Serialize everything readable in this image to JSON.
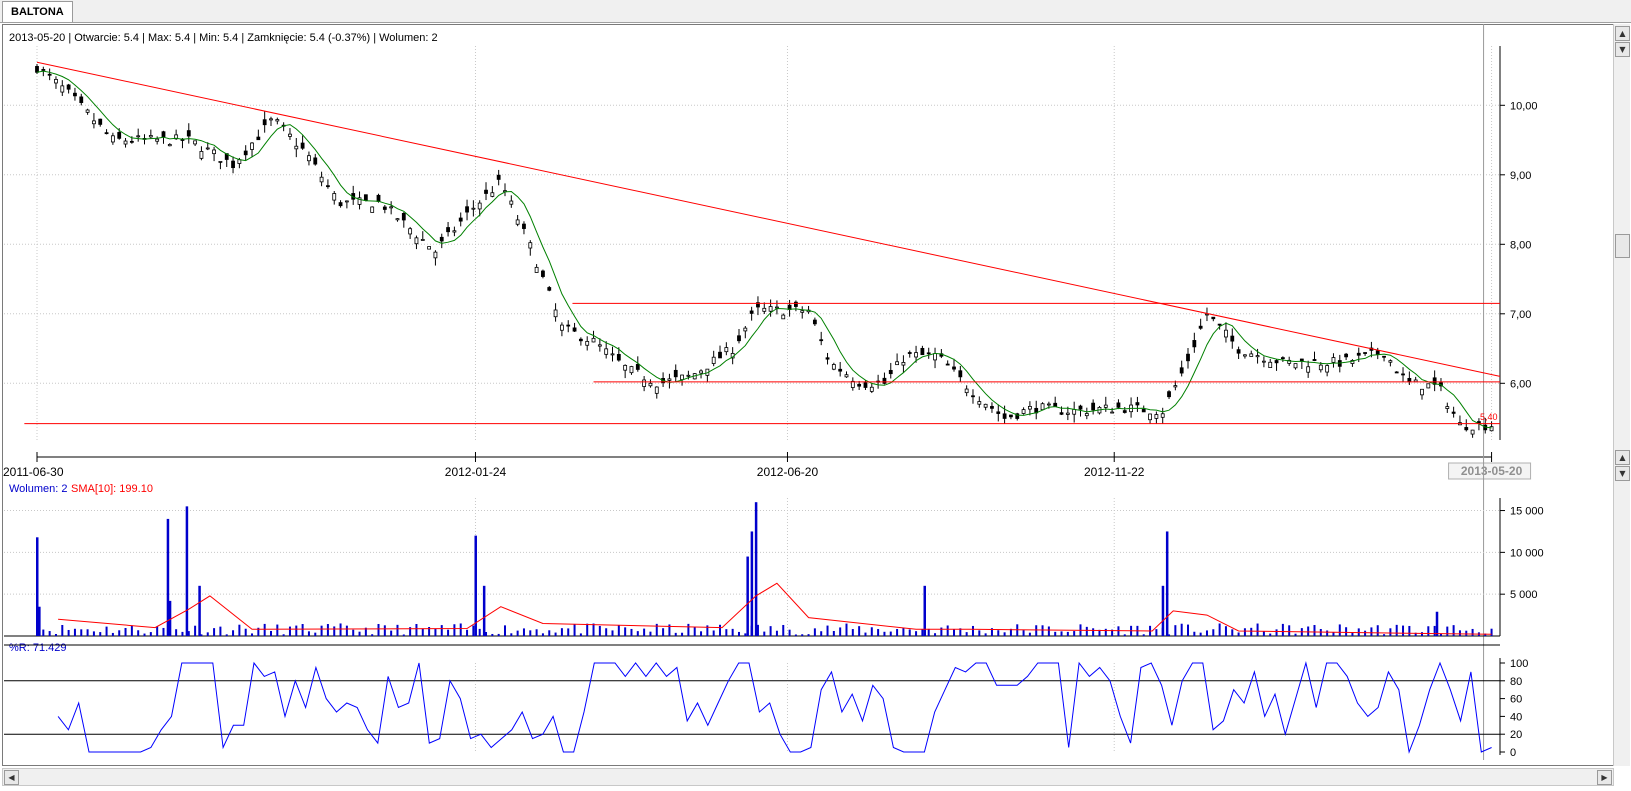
{
  "window": {
    "tab_label": "BALTONA"
  },
  "info_bar": {
    "text": "2013-05-20 | Otwarcie: 5.4 | Max: 5.4 | Min: 5.4 | Zamknięcie: 5.4 (-0.37%)  | Wolumen: 2"
  },
  "last_price_label": "5,40",
  "current_date_label": "2013-05-20",
  "volume_panel": {
    "label": "Wolumen: 2",
    "sma_label": "SMA[10]: 199.10"
  },
  "wr_panel": {
    "label": "%R: 71.429"
  },
  "colors": {
    "price_bar": "#000000",
    "sma_line": "#008000",
    "trend_lines": "#ff0000",
    "volume_bars": "#0000cc",
    "volume_sma": "#ff0000",
    "wr_line": "#0000ff"
  },
  "icons": [
    "scroll-up-icon",
    "scroll-down-icon",
    "scroll-left-icon",
    "scroll-right-icon"
  ],
  "chart_data": [
    {
      "type": "line",
      "name": "price",
      "x_tick_labels": [
        "2011-06-30",
        "2012-01-24",
        "2012-06-20",
        "2012-11-22",
        "2013-05-20"
      ],
      "y_tick_labels": [
        "6,00",
        "7,00",
        "8,00",
        "9,00",
        "10,00"
      ],
      "ylim": [
        5.25,
        10.9
      ],
      "xlim": [
        "2011-06-30",
        "2013-05-24"
      ],
      "price_path": [
        [
          "2011-06-30",
          10.55
        ],
        [
          "2011-07-14",
          10.2
        ],
        [
          "2011-08-05",
          9.5
        ],
        [
          "2011-09-10",
          9.5
        ],
        [
          "2011-10-01",
          9.15
        ],
        [
          "2011-10-20",
          9.8
        ],
        [
          "2011-11-05",
          9.3
        ],
        [
          "2011-11-20",
          8.6
        ],
        [
          "2011-12-10",
          8.6
        ],
        [
          "2012-01-05",
          7.9
        ],
        [
          "2012-01-22",
          8.5
        ],
        [
          "2012-02-05",
          8.9
        ],
        [
          "2012-02-20",
          7.9
        ],
        [
          "2012-03-05",
          6.8
        ],
        [
          "2012-03-20",
          6.6
        ],
        [
          "2012-04-05",
          6.2
        ],
        [
          "2012-04-20",
          6.0
        ],
        [
          "2012-05-05",
          6.1
        ],
        [
          "2012-05-25",
          6.5
        ],
        [
          "2012-06-05",
          7.05
        ],
        [
          "2012-06-30",
          7.05
        ],
        [
          "2012-07-10",
          6.3
        ],
        [
          "2012-07-25",
          6.0
        ],
        [
          "2012-08-05",
          6.0
        ],
        [
          "2012-08-15",
          6.4
        ],
        [
          "2012-08-30",
          6.4
        ],
        [
          "2012-09-15",
          5.9
        ],
        [
          "2012-10-01",
          5.5
        ],
        [
          "2012-10-15",
          5.65
        ],
        [
          "2012-11-01",
          5.6
        ],
        [
          "2012-11-25",
          5.65
        ],
        [
          "2012-12-15",
          5.6
        ],
        [
          "2012-12-25",
          6.2
        ],
        [
          "2013-01-05",
          7.0
        ],
        [
          "2013-01-20",
          6.5
        ],
        [
          "2013-02-10",
          6.3
        ],
        [
          "2013-03-10",
          6.3
        ],
        [
          "2013-03-30",
          6.45
        ],
        [
          "2013-04-10",
          6.0
        ],
        [
          "2013-04-25",
          5.95
        ],
        [
          "2013-05-05",
          5.4
        ],
        [
          "2013-05-20",
          5.4
        ]
      ],
      "trend_lines": [
        {
          "from": [
            "2011-06-30",
            10.62
          ],
          "to": [
            "2013-05-24",
            6.1
          ]
        },
        {
          "from": [
            "2012-03-10",
            7.15
          ],
          "to": [
            "2013-05-24",
            7.15
          ]
        },
        {
          "from": [
            "2012-03-20",
            6.02
          ],
          "to": [
            "2013-05-24",
            6.02
          ]
        },
        {
          "from": [
            "2011-06-24",
            5.42
          ],
          "to": [
            "2013-05-24",
            5.42
          ]
        }
      ]
    },
    {
      "type": "bar",
      "name": "Wolumen",
      "y_tick_labels": [
        "5 000",
        "10 000",
        "15 000"
      ],
      "ylim": [
        0,
        16500
      ],
      "peaks": [
        [
          "2011-06-30",
          11800
        ],
        [
          "2011-07-01",
          3500
        ],
        [
          "2011-08-31",
          14000
        ],
        [
          "2011-09-01",
          4200
        ],
        [
          "2011-09-09",
          15500
        ],
        [
          "2011-09-15",
          6000
        ],
        [
          "2012-01-24",
          12000
        ],
        [
          "2012-01-28",
          6000
        ],
        [
          "2012-06-05",
          16000
        ],
        [
          "2012-06-03",
          12500
        ],
        [
          "2012-06-01",
          9500
        ],
        [
          "2012-08-24",
          6000
        ],
        [
          "2012-12-17",
          12500
        ],
        [
          "2012-12-15",
          6000
        ],
        [
          "2013-04-24",
          2900
        ]
      ],
      "base_level": 600,
      "sma_path": [
        [
          "2011-07-10",
          2000
        ],
        [
          "2011-08-25",
          1000
        ],
        [
          "2011-09-10",
          3200
        ],
        [
          "2011-09-20",
          4800
        ],
        [
          "2011-10-10",
          800
        ],
        [
          "2012-01-20",
          900
        ],
        [
          "2012-02-05",
          3500
        ],
        [
          "2012-02-25",
          1500
        ],
        [
          "2012-05-20",
          1000
        ],
        [
          "2012-06-05",
          4800
        ],
        [
          "2012-06-15",
          6300
        ],
        [
          "2012-06-30",
          2200
        ],
        [
          "2012-08-20",
          800
        ],
        [
          "2012-09-15",
          800
        ],
        [
          "2012-12-10",
          600
        ],
        [
          "2012-12-20",
          3000
        ],
        [
          "2013-01-05",
          2500
        ],
        [
          "2013-01-20",
          600
        ],
        [
          "2013-05-20",
          200
        ]
      ]
    },
    {
      "type": "line",
      "name": "%R",
      "y_tick_labels": [
        "0",
        "20",
        "40",
        "60",
        "80",
        "100"
      ],
      "ylim": [
        0,
        100
      ],
      "reference_lines": [
        20,
        80
      ],
      "x_range": [
        "2011-07-10",
        "2013-05-20"
      ],
      "values": [
        40,
        25,
        55,
        0,
        0,
        0,
        0,
        0,
        0,
        5,
        25,
        40,
        100,
        100,
        100,
        100,
        5,
        30,
        30,
        100,
        85,
        90,
        40,
        80,
        50,
        95,
        60,
        45,
        55,
        50,
        25,
        10,
        85,
        50,
        55,
        100,
        10,
        15,
        80,
        60,
        15,
        20,
        5,
        15,
        25,
        45,
        15,
        20,
        40,
        0,
        0,
        45,
        100,
        100,
        100,
        85,
        100,
        85,
        100,
        85,
        95,
        35,
        55,
        30,
        55,
        80,
        100,
        100,
        45,
        55,
        20,
        0,
        0,
        5,
        70,
        90,
        45,
        65,
        35,
        75,
        60,
        5,
        0,
        0,
        0,
        45,
        70,
        95,
        90,
        100,
        100,
        75,
        75,
        75,
        85,
        100,
        100,
        100,
        5,
        100,
        85,
        95,
        80,
        40,
        10,
        95,
        100,
        75,
        30,
        80,
        100,
        100,
        25,
        35,
        70,
        55,
        90,
        40,
        65,
        20,
        60,
        100,
        50,
        100,
        100,
        85,
        55,
        40,
        50,
        90,
        70,
        0,
        30,
        70,
        100,
        70,
        35,
        90,
        0,
        5
      ]
    }
  ]
}
